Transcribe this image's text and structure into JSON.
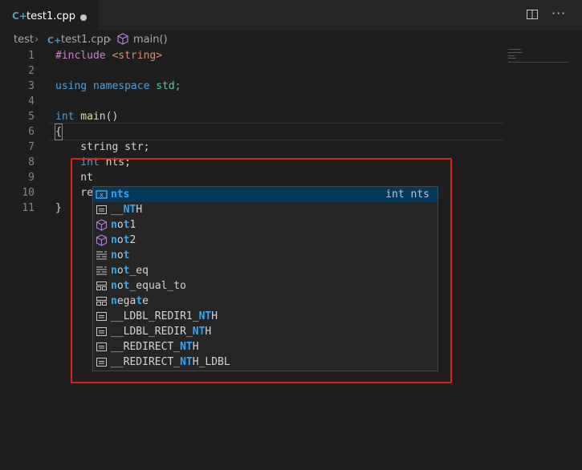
{
  "tab": {
    "label": "test1.cpp"
  },
  "breadcrumb": {
    "folder": "test",
    "file": "test1.cpp",
    "symbol": "main()"
  },
  "lines": [
    {
      "n": "1"
    },
    {
      "n": "2"
    },
    {
      "n": "3"
    },
    {
      "n": "4"
    },
    {
      "n": "5"
    },
    {
      "n": "6"
    },
    {
      "n": "7"
    },
    {
      "n": "8"
    },
    {
      "n": "9"
    },
    {
      "n": "10"
    },
    {
      "n": "11"
    }
  ],
  "code": {
    "l1a": "#include",
    "l1b": " <string>",
    "l3a": "using",
    "l3b": " namespace",
    "l3c": " std;",
    "l5a": "int",
    "l5b": " main",
    "l5c": "()",
    "l6": "{",
    "l7": "    string str;",
    "l8a": "    int",
    "l8b": " nts;",
    "l9": "    nt",
    "l10": "    re",
    "l11": "}"
  },
  "suggest": {
    "items": [
      {
        "pre": "",
        "m": "nts",
        "post": "",
        "icon": "variable-icon",
        "detail": "int nts"
      },
      {
        "pre": "__",
        "m": "NT",
        "post": "H",
        "icon": "constant-icon"
      },
      {
        "pre": "",
        "m": "n",
        "m2": "ot",
        "post": "1",
        "icon": "cube-icon",
        "raw": "not1"
      },
      {
        "pre": "",
        "m": "n",
        "m2": "ot",
        "post": "2",
        "icon": "cube-icon",
        "raw": "not2"
      },
      {
        "pre": "",
        "m": "not",
        "post": "",
        "icon": "keyword-icon"
      },
      {
        "pre": "",
        "m": "not",
        "post": "_eq",
        "icon": "keyword-icon"
      },
      {
        "pre": "",
        "m": "not",
        "post": "_equal_to",
        "icon": "struct-icon"
      },
      {
        "pre": "",
        "m": "neg",
        "m2": "a",
        "post": "te",
        "icon": "struct-icon",
        "raw": "negate"
      },
      {
        "pre": "__LDBL_REDIR1_",
        "m": "NT",
        "post": "H",
        "icon": "constant-icon"
      },
      {
        "pre": "__LDBL_REDIR_",
        "m": "NT",
        "post": "H",
        "icon": "constant-icon"
      },
      {
        "pre": "__REDIRECT_",
        "m": "NT",
        "post": "H",
        "icon": "constant-icon"
      },
      {
        "pre": "__REDIRECT_",
        "m": "NT",
        "post": "H_LDBL",
        "icon": "constant-icon"
      }
    ]
  },
  "colors": {
    "accent": "#2aaaff",
    "annotation": "#e0201a",
    "selection": "#04395e"
  }
}
